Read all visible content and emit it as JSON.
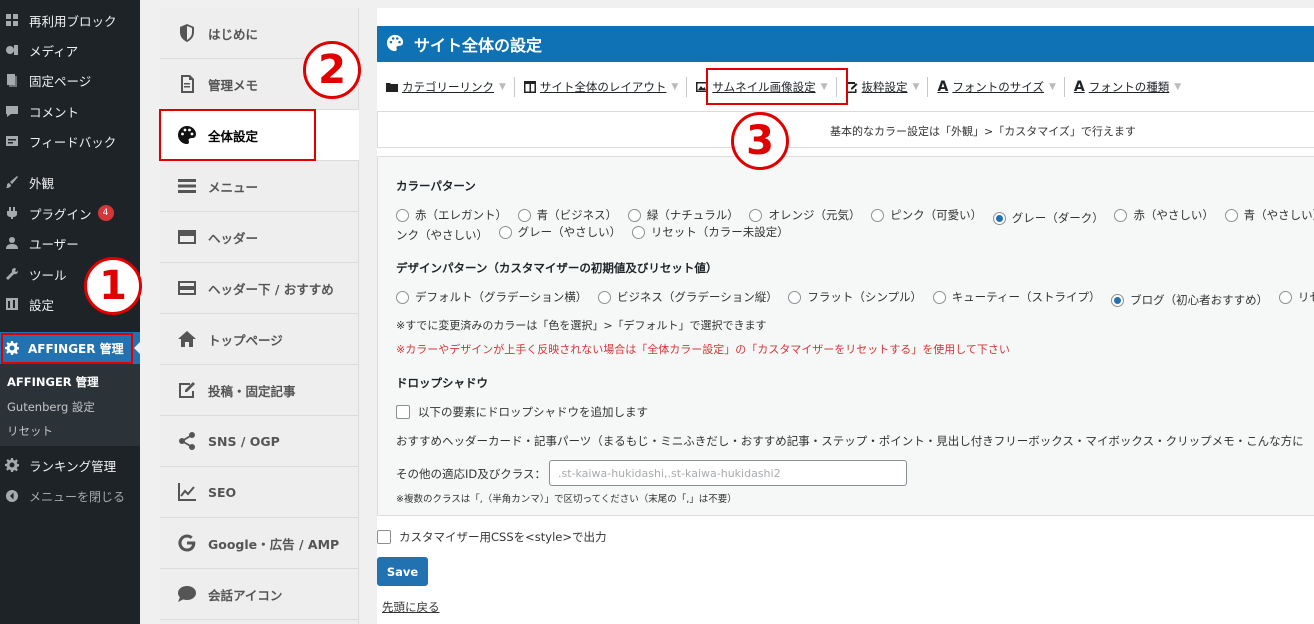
{
  "sidebar": {
    "items": [
      {
        "label": "再利用ブロック",
        "icon": "grid-icon"
      },
      {
        "label": "メディア",
        "icon": "media-icon"
      },
      {
        "label": "固定ページ",
        "icon": "pages-icon"
      },
      {
        "label": "コメント",
        "icon": "comment-icon"
      },
      {
        "label": "フィードバック",
        "icon": "feedback-icon"
      },
      {
        "label": "外観",
        "icon": "paintbrush-icon"
      },
      {
        "label": "プラグイン",
        "icon": "plugin-icon",
        "badge": "4"
      },
      {
        "label": "ユーザー",
        "icon": "user-icon"
      },
      {
        "label": "ツール",
        "icon": "wrench-icon"
      },
      {
        "label": "設定",
        "icon": "settings-icon"
      }
    ],
    "active": {
      "label": "AFFINGER 管理",
      "icon": "gear-icon"
    },
    "sub_items": [
      "AFFINGER 管理",
      "Gutenberg 設定",
      "リセット"
    ],
    "after": [
      {
        "label": "ランキング管理",
        "icon": "gear-icon"
      },
      {
        "label": "メニューを閉じる",
        "icon": "collapse-icon"
      }
    ]
  },
  "annotations": {
    "one": "1",
    "two": "2",
    "three": "3",
    "color": "#e00000"
  },
  "aff_menu": {
    "items": [
      {
        "label": "はじめに",
        "icon": "shield-icon"
      },
      {
        "label": "管理メモ",
        "icon": "memo-icon"
      },
      {
        "label": "全体設定",
        "icon": "palette-icon",
        "active": true
      },
      {
        "label": "メニュー",
        "icon": "hamburger-icon"
      },
      {
        "label": "ヘッダー",
        "icon": "header-icon"
      },
      {
        "label": "ヘッダー下 / おすすめ",
        "icon": "header-below-icon"
      },
      {
        "label": "トップページ",
        "icon": "home-icon"
      },
      {
        "label": "投稿・固定記事",
        "icon": "edit-icon"
      },
      {
        "label": "SNS / OGP",
        "icon": "share-icon"
      },
      {
        "label": "SEO",
        "icon": "chart-line-icon"
      },
      {
        "label": "Google・広告 / AMP",
        "icon": "google-icon"
      },
      {
        "label": "会話アイコン",
        "icon": "speech-bubble-icon"
      }
    ]
  },
  "panel": {
    "title": "サイト全体の設定",
    "accent": "#0f72b4",
    "tabs": [
      {
        "label": "カテゴリーリンク",
        "icon": "folder-icon"
      },
      {
        "label": "サイト全体のレイアウト",
        "icon": "layout-icon"
      },
      {
        "label": "サムネイル画像設定",
        "icon": "image-icon"
      },
      {
        "label": "抜粋設定",
        "icon": "excerpt-icon"
      },
      {
        "label": "フォントのサイズ",
        "glyph": "A"
      },
      {
        "label": "フォントの種類",
        "glyph": "A"
      }
    ],
    "info": "基本的なカラー設定は「外観」>「カスタマイズ」で行えます"
  },
  "color_pattern": {
    "title": "カラーパターン",
    "row1": [
      {
        "label": "赤（エレガント）",
        "checked": false
      },
      {
        "label": "青（ビジネス）",
        "checked": false
      },
      {
        "label": "緑（ナチュラル）",
        "checked": false
      },
      {
        "label": "オレンジ（元気）",
        "checked": false
      },
      {
        "label": "ピンク（可愛い）",
        "checked": false
      },
      {
        "label": "グレー（ダーク）",
        "checked": true
      },
      {
        "label": "赤（やさしい）",
        "checked": false
      },
      {
        "label": "青（やさしい）",
        "checked": false
      }
    ],
    "row2_prefix": "ンク（やさしい）",
    "row2": [
      {
        "label": "グレー（やさしい）",
        "checked": false
      },
      {
        "label": "リセット（カラー未設定）",
        "checked": false
      }
    ]
  },
  "design_pattern": {
    "title": "デザインパターン（カスタマイザーの初期値及びリセット値）",
    "options": [
      {
        "label": "デフォルト（グラデーション横）",
        "checked": false
      },
      {
        "label": "ビジネス（グラデーション縦）",
        "checked": false
      },
      {
        "label": "フラット（シンプル）",
        "checked": false
      },
      {
        "label": "キューティー（ストライプ）",
        "checked": false
      },
      {
        "label": "ブログ（初心者おすすめ）",
        "checked": true
      },
      {
        "label": "リセ",
        "checked": false
      }
    ],
    "note": "※すでに変更済みのカラーは「色を選択」>「デフォルト」で選択できます",
    "warning": "※カラーやデザインが上手く反映されない場合は「全体カラー設定」の「カスタマイザーをリセットする」を使用して下さい"
  },
  "drop_shadow": {
    "title": "ドロップシャドウ",
    "checkbox_label": "以下の要素にドロップシャドウを追加します",
    "description": "おすすめヘッダーカード・記事パーツ（まるもじ・ミニふきだし・おすすめ記事・ステップ・ポイント・見出し付きフリーボックス・マイボックス・クリップメモ・こんな方に",
    "field_label": "その他の適応ID及びクラス：",
    "field_placeholder": ".st-kaiwa-hukidashi,.st-kaiwa-hukidashi2",
    "field_note": "※複数のクラスは「,（半角カンマ）」で区切ってください（末尾の「,」は不要）"
  },
  "footer": {
    "css_checkbox_label": "カスタマイザー用CSSを<style>で出力",
    "save_label": "Save",
    "back_link": "先頭に戻る"
  }
}
